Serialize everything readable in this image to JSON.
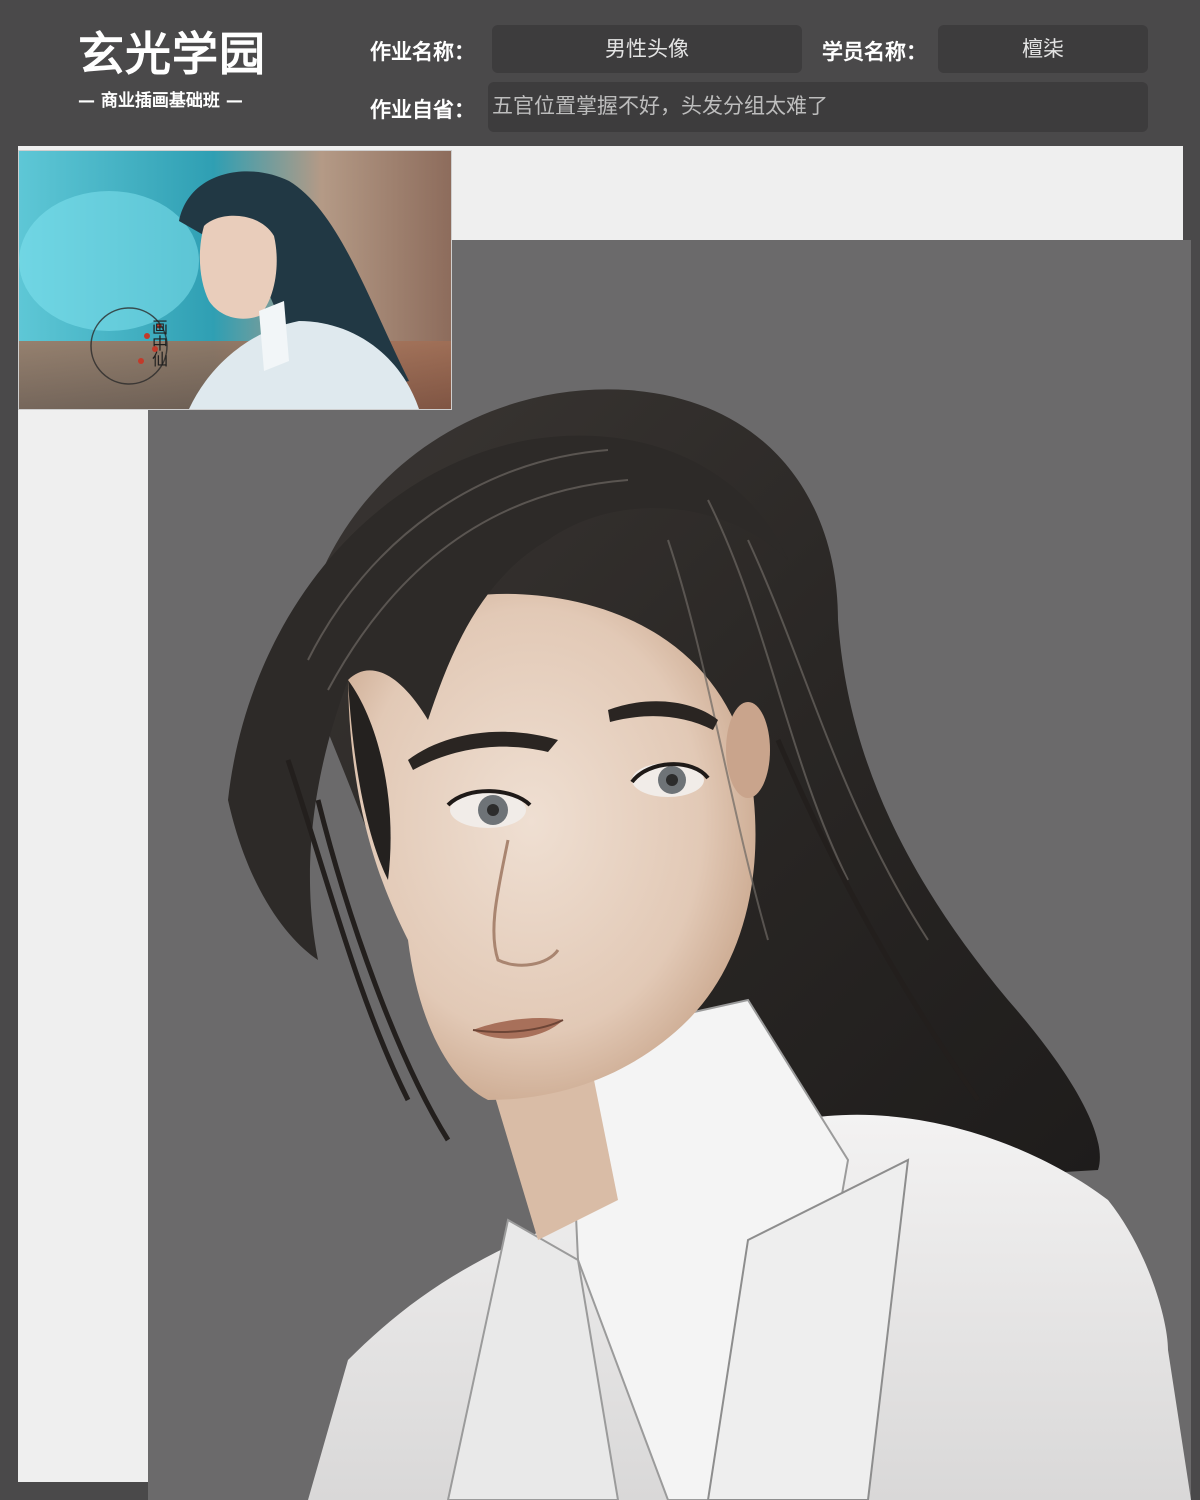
{
  "header": {
    "logo_title": "玄光学园",
    "logo_subtitle": "— 商业插画基础班 —",
    "assignment_name_label": "作业名称：",
    "assignment_name_value": "男性头像",
    "student_name_label": "学员名称：",
    "student_name_value": "檀柒",
    "reflection_label": "作业自省：",
    "reflection_value": "五官位置掌握不好，头发分组太难了"
  },
  "reference_image": {
    "seal_text": "画中仙"
  },
  "colors": {
    "background": "#4a494a",
    "field_box": "#3d3c3d",
    "artwork_bg": "#6b6a6b",
    "light_panel": "#efefef",
    "hair": "#2b2826",
    "skin": "#e6d2c4",
    "robe": "#ecebea",
    "teal": "#3fb4c6"
  }
}
